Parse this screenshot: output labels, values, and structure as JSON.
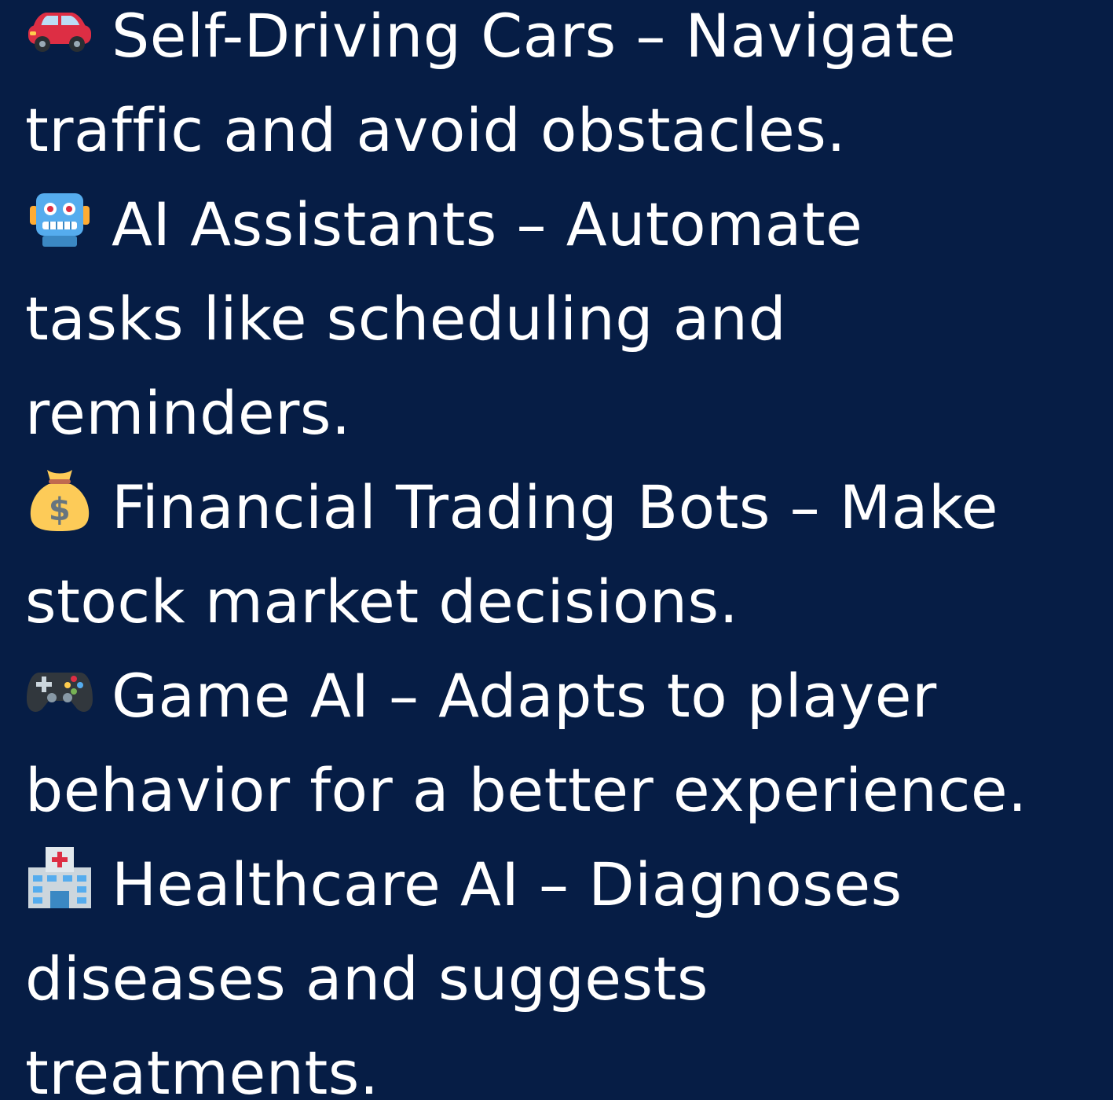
{
  "items": [
    {
      "icon": "car-icon",
      "lines": [
        "Self-Driving Cars – Navigate",
        "traffic and avoid obstacles."
      ]
    },
    {
      "icon": "robot-icon",
      "lines": [
        "AI Assistants – Automate",
        "tasks like scheduling and",
        "reminders."
      ]
    },
    {
      "icon": "money-bag-icon",
      "lines": [
        "Financial Trading Bots – Make",
        "stock market decisions."
      ]
    },
    {
      "icon": "game-controller-icon",
      "lines": [
        "Game AI – Adapts to player",
        "behavior for a better experience."
      ]
    },
    {
      "icon": "hospital-icon",
      "lines": [
        "Healthcare AI – Diagnoses",
        "diseases and suggests",
        "treatments."
      ]
    }
  ],
  "colors": {
    "background": "#061d45",
    "text": "#ffffff"
  }
}
